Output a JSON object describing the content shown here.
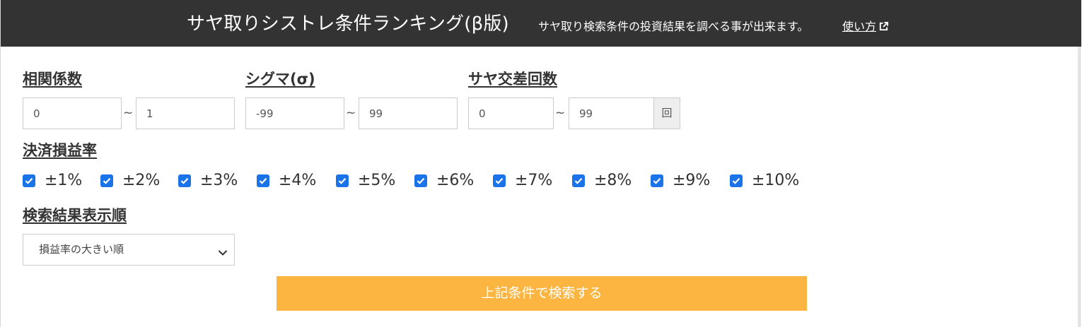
{
  "header": {
    "title": "サヤ取りシストレ条件ランキング(β版)",
    "description": "サヤ取り検索条件の投資結果を調べる事が出来ます。",
    "help_link": "使い方"
  },
  "correlation": {
    "label": "相関係数",
    "min": "0",
    "max": "1",
    "separator": "~"
  },
  "sigma": {
    "label": "シグマ(σ)",
    "min": "-99",
    "max": "99",
    "separator": "~"
  },
  "crossings": {
    "label": "サヤ交差回数",
    "min": "0",
    "max": "99",
    "separator": "~",
    "unit": "回"
  },
  "profit_rate": {
    "label": "決済損益率",
    "options": [
      {
        "label": "±1%",
        "checked": true
      },
      {
        "label": "±2%",
        "checked": true
      },
      {
        "label": "±3%",
        "checked": true
      },
      {
        "label": "±4%",
        "checked": true
      },
      {
        "label": "±5%",
        "checked": true
      },
      {
        "label": "±6%",
        "checked": true
      },
      {
        "label": "±7%",
        "checked": true
      },
      {
        "label": "±8%",
        "checked": true
      },
      {
        "label": "±9%",
        "checked": true
      },
      {
        "label": "±10%",
        "checked": true
      }
    ]
  },
  "sort_order": {
    "label": "検索結果表示順",
    "selected": "損益率の大きい順"
  },
  "search_button": {
    "label": "上記条件で検索する"
  },
  "colors": {
    "header_bg": "#333333",
    "accent_button": "#fbb540",
    "checkbox": "#1a73e8"
  }
}
